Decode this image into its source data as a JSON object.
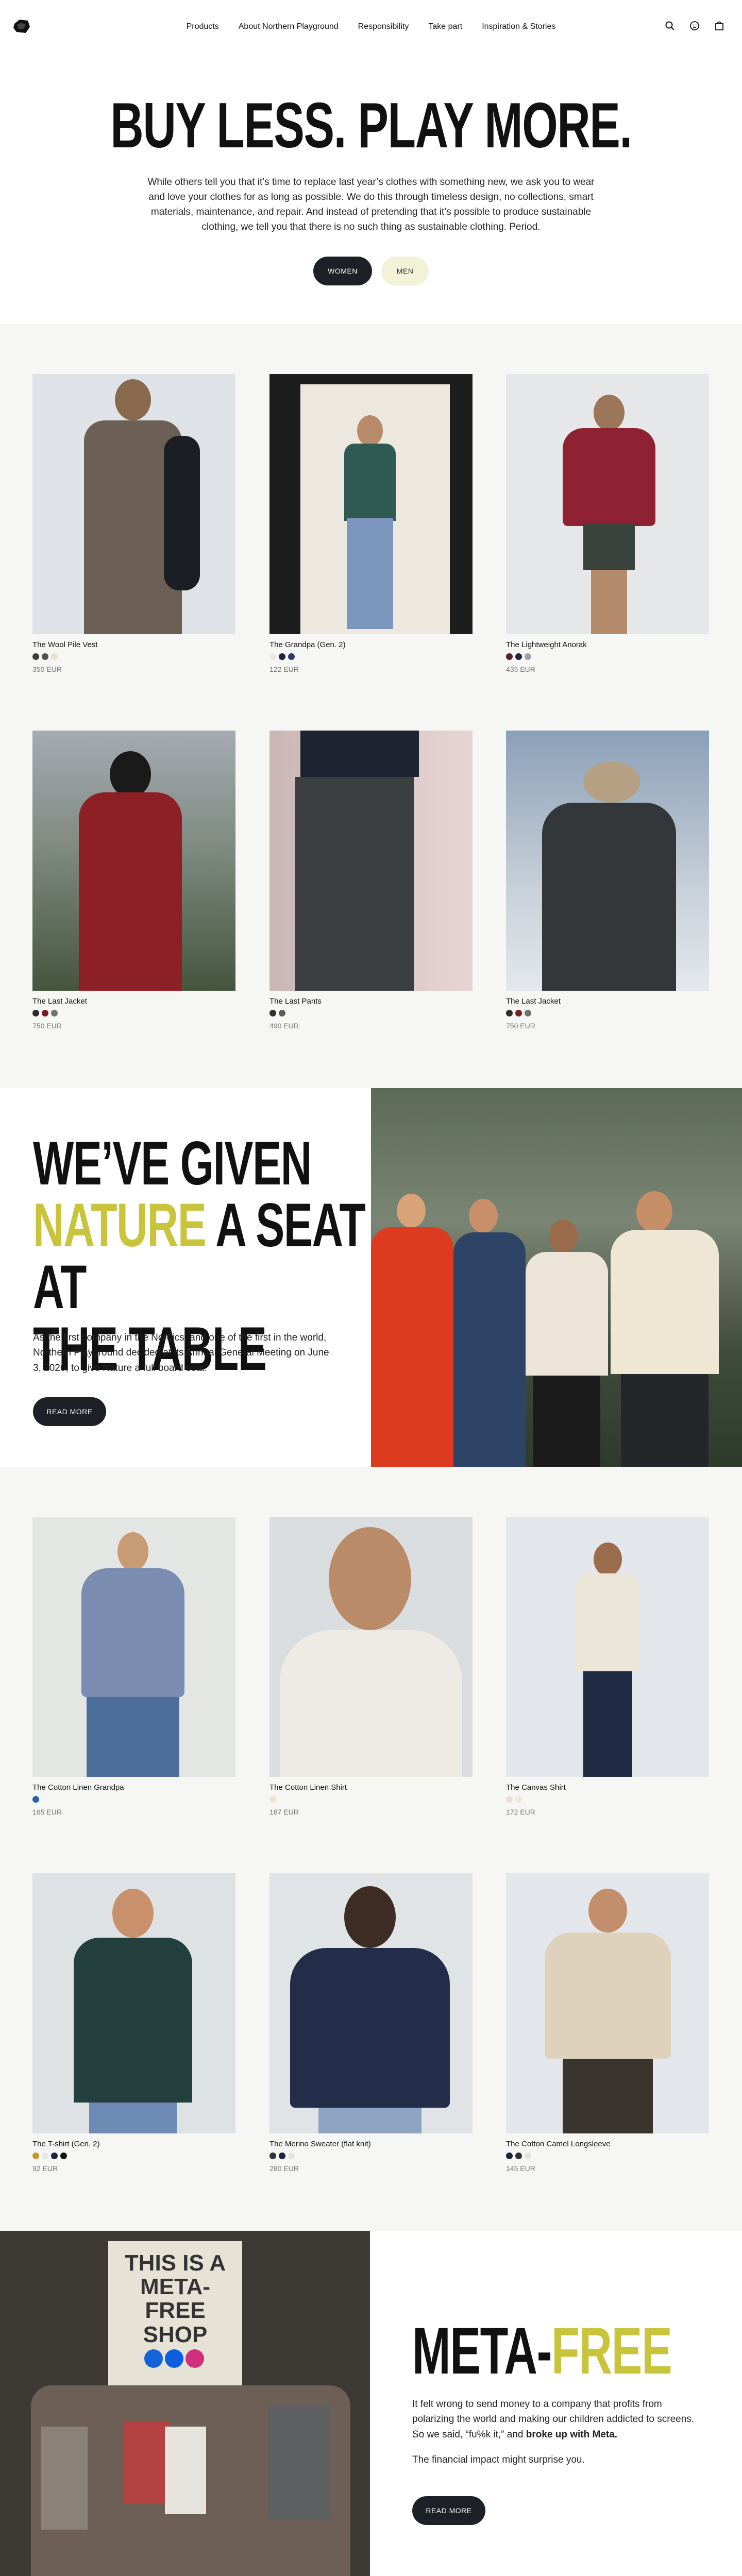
{
  "header": {
    "nav": [
      "Products",
      "About Northern Playground",
      "Responsibility",
      "Take part",
      "Inspiration & Stories"
    ],
    "icons": [
      "search-icon",
      "account-icon",
      "bag-icon"
    ]
  },
  "hero": {
    "title": "BUY LESS. PLAY MORE.",
    "body": "While others tell you that it’s time to replace last year’s clothes with something new, we ask you to wear and love your clothes for as long as possible. We do this through timeless design, no collections, smart materials, maintenance, and repair. And instead of pretending that it’s possible to produce sustainable clothing, we tell you that there is no such thing as sustainable clothing. Period.",
    "button_women": "WOMEN",
    "button_men": "MEN"
  },
  "products_women": [
    {
      "name": "The Wool Pile Vest",
      "price": "350 EUR",
      "swatches": [
        "#3a3f3a",
        "#55504a",
        "#e8e1d2"
      ]
    },
    {
      "name": "The Grandpa (Gen. 2)",
      "price": "122 EUR",
      "swatches": [
        "#ece8df",
        "#1f2240",
        "#2b3a6b"
      ]
    },
    {
      "name": "The Lightweight Anorak",
      "price": "435 EUR",
      "swatches": [
        "#5a1f2a",
        "#1f2240",
        "#9aa4ae"
      ]
    },
    {
      "name": "The Last Jacket",
      "price": "750 EUR",
      "swatches": [
        "#2b2b2b",
        "#7a1e24",
        "#6f746a"
      ]
    },
    {
      "name": "The Last Pants",
      "price": "490 EUR",
      "swatches": [
        "#2f3232",
        "#55604e"
      ]
    },
    {
      "name": "The Last Jacket",
      "price": "750 EUR",
      "swatches": [
        "#2b2b2b",
        "#7a1e24",
        "#6f746a"
      ]
    }
  ],
  "feature": {
    "title_line1": "WE’VE GIVEN",
    "title_accent": "NATURE",
    "title_line2": " A SEAT AT",
    "title_line3": "THE TABLE",
    "body": "As the first company in the Nordics, and one of the first in the world, Northern Playground decided at its Annual General Meeting on June 3, 2026, to give Nature a full board seat.",
    "button": "READ MORE"
  },
  "products_men": [
    {
      "name": "The Cotton Linen Grandpa",
      "price": "165 EUR",
      "swatches": [
        "#2a63a5"
      ]
    },
    {
      "name": "The Cotton Linen Shirt",
      "price": "167 EUR",
      "swatches": [
        "#efe3c9"
      ]
    },
    {
      "name": "The Canvas Shirt",
      "price": "172 EUR",
      "swatches": [
        "#ebe1d3",
        "#ece8df"
      ]
    },
    {
      "name": "The T-shirt (Gen. 2)",
      "price": "92 EUR",
      "swatches": [
        "#c79a2e",
        "#e8e6e1",
        "#1f2240",
        "#111111"
      ]
    },
    {
      "name": "The Merino Sweater (flat knit)",
      "price": "280 EUR",
      "swatches": [
        "#30343d",
        "#1f2240",
        "#e7e3dc"
      ]
    },
    {
      "name": "The Cotton Camel Longsleeve",
      "price": "145 EUR",
      "swatches": [
        "#1f2240",
        "#2c2f33",
        "#e7e3dc"
      ]
    }
  ],
  "meta": {
    "title_main": "META",
    "title_dash": "-",
    "title_accent": "FREE",
    "body": "It felt wrong to send money to a company that profits from polarizing the world and making our children addicted to screens. So we said, “fu%k it,” and ",
    "body_bold": "broke up with Meta.",
    "body2": "The financial impact might surprise you.",
    "button": "READ MORE",
    "sign_text": "THIS IS A META-FREE SHOP"
  }
}
